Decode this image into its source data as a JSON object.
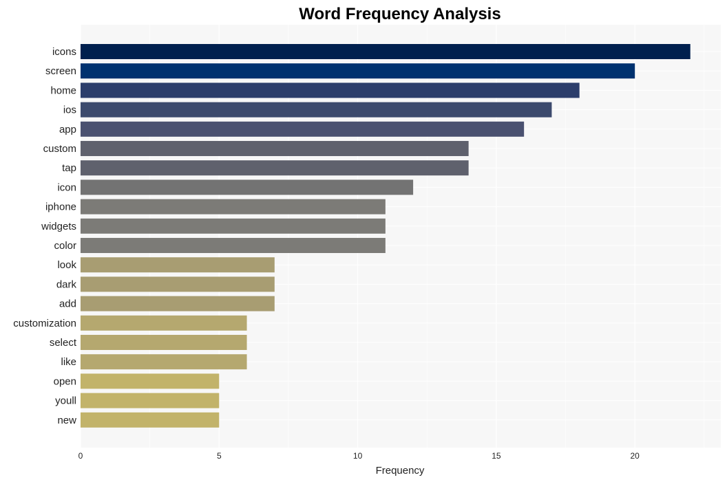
{
  "chart_data": {
    "type": "bar",
    "orientation": "horizontal",
    "title": "Word Frequency Analysis",
    "xlabel": "Frequency",
    "ylabel": "",
    "xlim": [
      0,
      23.1
    ],
    "xticks": [
      0,
      5,
      10,
      15,
      20
    ],
    "grid": true,
    "legend": "none",
    "categories": [
      "icons",
      "screen",
      "home",
      "ios",
      "app",
      "custom",
      "tap",
      "icon",
      "iphone",
      "widgets",
      "color",
      "look",
      "dark",
      "add",
      "customization",
      "select",
      "like",
      "open",
      "youll",
      "new"
    ],
    "values": [
      22,
      20,
      18,
      17,
      16,
      14,
      14,
      12,
      11,
      11,
      11,
      7,
      7,
      7,
      6,
      6,
      6,
      5,
      5,
      5
    ],
    "colors": [
      "#00204e",
      "#00326f",
      "#2c3e6b",
      "#3c4a6d",
      "#4a5170",
      "#5f616d",
      "#5f616d",
      "#737373",
      "#7c7b77",
      "#7c7b77",
      "#7c7b77",
      "#a89d72",
      "#a89d72",
      "#a89d72",
      "#b5a86f",
      "#b5a86f",
      "#b5a86f",
      "#c2b36a",
      "#c2b36a",
      "#c2b36a"
    ],
    "background": "#f7f7f7"
  }
}
